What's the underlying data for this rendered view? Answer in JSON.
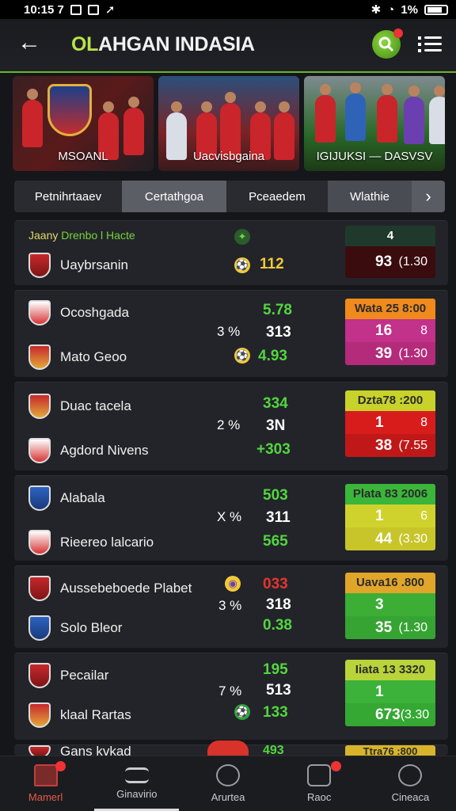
{
  "status": {
    "time": "10:15 7",
    "battery": "1%"
  },
  "header": {
    "title_first": "OL",
    "title_rest": "AHGAN INDASIA"
  },
  "banners": [
    {
      "label": "MSOANL"
    },
    {
      "label": "Uacvisbgaina"
    },
    {
      "label": "IGIJUKSI  —  DASVSV"
    }
  ],
  "tabs": [
    {
      "label": "Petnihrtaaev"
    },
    {
      "label": "Certathgoa"
    },
    {
      "label": "Pceaedem"
    },
    {
      "label": "Wlathie"
    }
  ],
  "matches": [
    {
      "league": "Jaany",
      "league_hl": "Drenbo l Hacte",
      "team1": "",
      "team2": "Uaybrsanin",
      "mid": "",
      "s1": "",
      "s2": "",
      "s3": "112",
      "odds_head": "4",
      "odds1": "",
      "odds1b": "",
      "odds2": "93",
      "odds2b": "(1.30"
    },
    {
      "team1": "Ocoshgada",
      "team2": "Mato Geoo",
      "mid": "3 %",
      "s1": "5.78",
      "s2": "313",
      "s3": "4.93",
      "odds_head": "Wata 25 8:00",
      "odds1": "16",
      "odds1b": "8",
      "odds2": "39",
      "odds2b": "(1.30"
    },
    {
      "team1": "Duac tacela",
      "team2": "Agdord Nivens",
      "mid": "2 %",
      "s1": "334",
      "s2": "3N",
      "s3": "+303",
      "odds_head": "Dzta78 :200",
      "odds1": "1",
      "odds1b": "8",
      "odds2": "38",
      "odds2b": "(7.55"
    },
    {
      "team1": "Alabala",
      "team2": "Rieereo lalcario",
      "mid": "X %",
      "s1": "503",
      "s2": "311",
      "s3": "565",
      "odds_head": "Plata 83 2006",
      "odds1": "1",
      "odds1b": "6",
      "odds2": "44",
      "odds2b": "(3.30"
    },
    {
      "team1": "Aussebeboede Plabet",
      "team2": "Solo Bleor",
      "mid": "3 %",
      "s1": "033",
      "s2": "318",
      "s3": "0.38",
      "odds_head": "Uava16 .800",
      "odds1": "3",
      "odds1b": "",
      "odds2": "35",
      "odds2b": "(1.30"
    },
    {
      "team1": "Pecailar",
      "team2": "klaal Rartas",
      "mid": "7 %",
      "s1": "195",
      "s2": "513",
      "s3": "133",
      "odds_head": "Iiata 13 3320",
      "odds1": "1",
      "odds1b": "",
      "odds2": "673",
      "odds2b": "(3.30"
    },
    {
      "team1": "Gans kvkad",
      "s1": "493",
      "odds_head": "Ttra76 :800"
    }
  ],
  "nav": [
    {
      "label": "Mamerl"
    },
    {
      "label": "Ginavirio"
    },
    {
      "label": "Arurtea"
    },
    {
      "label": "Raoc"
    },
    {
      "label": "Cineaca"
    }
  ],
  "colors": {
    "accent": "#6bb52a",
    "gold": "#f0c93b",
    "score_green": "#52d640",
    "live_red": "#e5352f"
  }
}
